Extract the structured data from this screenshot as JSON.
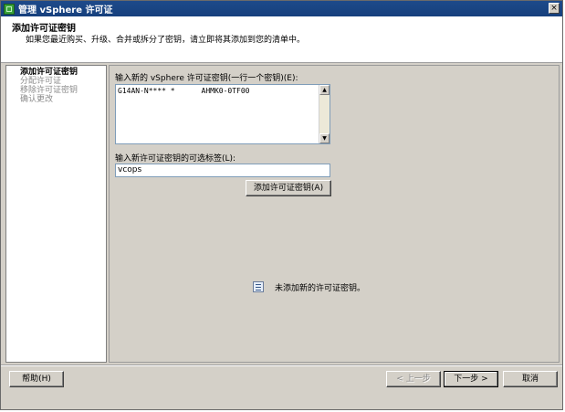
{
  "window": {
    "title": "管理 vSphere 许可证",
    "close_label": "×"
  },
  "header": {
    "title": "添加许可证密钥",
    "subtitle": "如果您最近购买、升级、合并或拆分了密钥，请立即将其添加到您的清单中。"
  },
  "steps": [
    {
      "label": "添加许可证密钥",
      "active": true
    },
    {
      "label": "分配许可证",
      "active": false
    },
    {
      "label": "移除许可证密钥",
      "active": false
    },
    {
      "label": "确认更改",
      "active": false
    }
  ],
  "form": {
    "keys_label": "输入新的 vSphere 许可证密钥(一行一个密钥)(E):",
    "keys_value": "G14AN-N**** *      AHMK0-0TF00",
    "tag_label": "输入新许可证密钥的可选标签(L):",
    "tag_value": "vcops",
    "add_button": "添加许可证密钥(A)",
    "empty_message": "未添加新的许可证密钥。"
  },
  "footer": {
    "help": "帮助(H)",
    "prev": "< 上一步",
    "next": "下一步 >",
    "cancel": "取消"
  },
  "icons": {
    "app": "vsphere-license-icon",
    "empty": "info-list-icon"
  }
}
